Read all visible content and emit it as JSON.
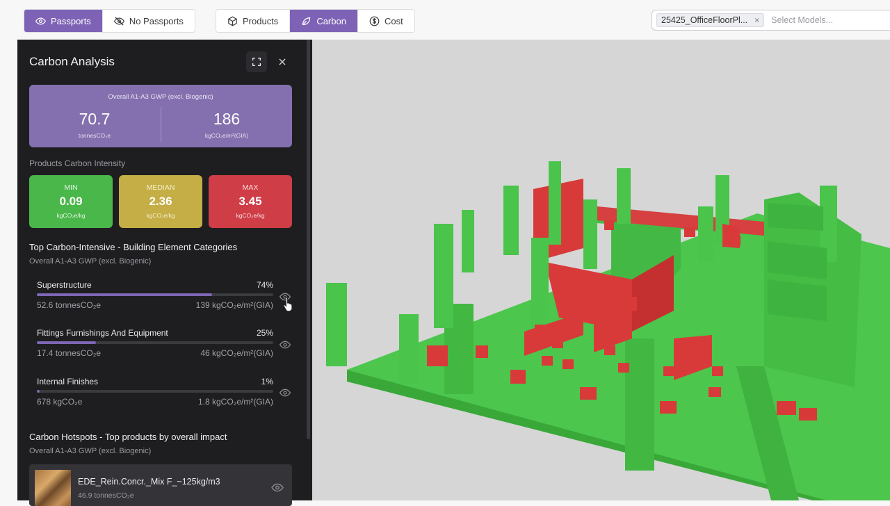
{
  "toolbar": {
    "passports_group": [
      {
        "label": "Passports",
        "icon": "eye-icon",
        "active": true
      },
      {
        "label": "No Passports",
        "icon": "eye-off-icon",
        "active": false
      }
    ],
    "analysis_group": [
      {
        "label": "Products",
        "icon": "cube-icon",
        "active": false
      },
      {
        "label": "Carbon",
        "icon": "leaf-icon",
        "active": true
      },
      {
        "label": "Cost",
        "icon": "dollar-icon",
        "active": false
      }
    ],
    "model_select": {
      "chip": "25425_OfficeFloorPl...",
      "chip_remove": "×",
      "placeholder": "Select Models..."
    }
  },
  "panel": {
    "title": "Carbon Analysis",
    "overall": {
      "caption": "Overall A1-A3 GWP (excl. Biogenic)",
      "total_value": "70.7",
      "total_unit": "tonnesCO₂e",
      "intensity_value": "186",
      "intensity_unit": "kgCO₂e/m²(GIA)"
    },
    "intensity_label": "Products Carbon Intensity",
    "intensity": {
      "min": {
        "label": "MIN",
        "value": "0.09",
        "unit": "kgCO₂e/kg"
      },
      "median": {
        "label": "MEDIAN",
        "value": "2.36",
        "unit": "kgCO₂e/kg"
      },
      "max": {
        "label": "MAX",
        "value": "3.45",
        "unit": "kgCO₂e/kg"
      }
    },
    "categories_title": "Top Carbon-Intensive - Building Element Categories",
    "categories_subtitle": "Overall A1-A3 GWP (excl. Biogenic)",
    "categories": [
      {
        "name": "Superstructure",
        "percent": "74%",
        "fraction": 0.74,
        "total": "52.6 tonnesCO₂e",
        "intensity": "139 kgCO₂e/m²(GIA)"
      },
      {
        "name": "Fittings Furnishings And Equipment",
        "percent": "25%",
        "fraction": 0.25,
        "total": "17.4 tonnesCO₂e",
        "intensity": "46 kgCO₂e/m²(GIA)"
      },
      {
        "name": "Internal Finishes",
        "percent": "1%",
        "fraction": 0.01,
        "total": "678 kgCO₂e",
        "intensity": "1.8 kgCO₂e/m²(GIA)"
      }
    ],
    "hotspots_title": "Carbon Hotspots - Top products by overall impact",
    "hotspots_subtitle": "Overall A1-A3 GWP (excl. Biogenic)",
    "hotspots": [
      {
        "name": "EDE_Rein.Concr._Mix F_~125kg/m3",
        "total": "46.9 tonnesCO₂e"
      }
    ]
  },
  "colors": {
    "accent_purple": "#7d62b5",
    "low_green": "#4ab74a",
    "median_yellow": "#c4ae45",
    "high_red": "#cf3d47",
    "panel_bg": "#1e1e20"
  }
}
